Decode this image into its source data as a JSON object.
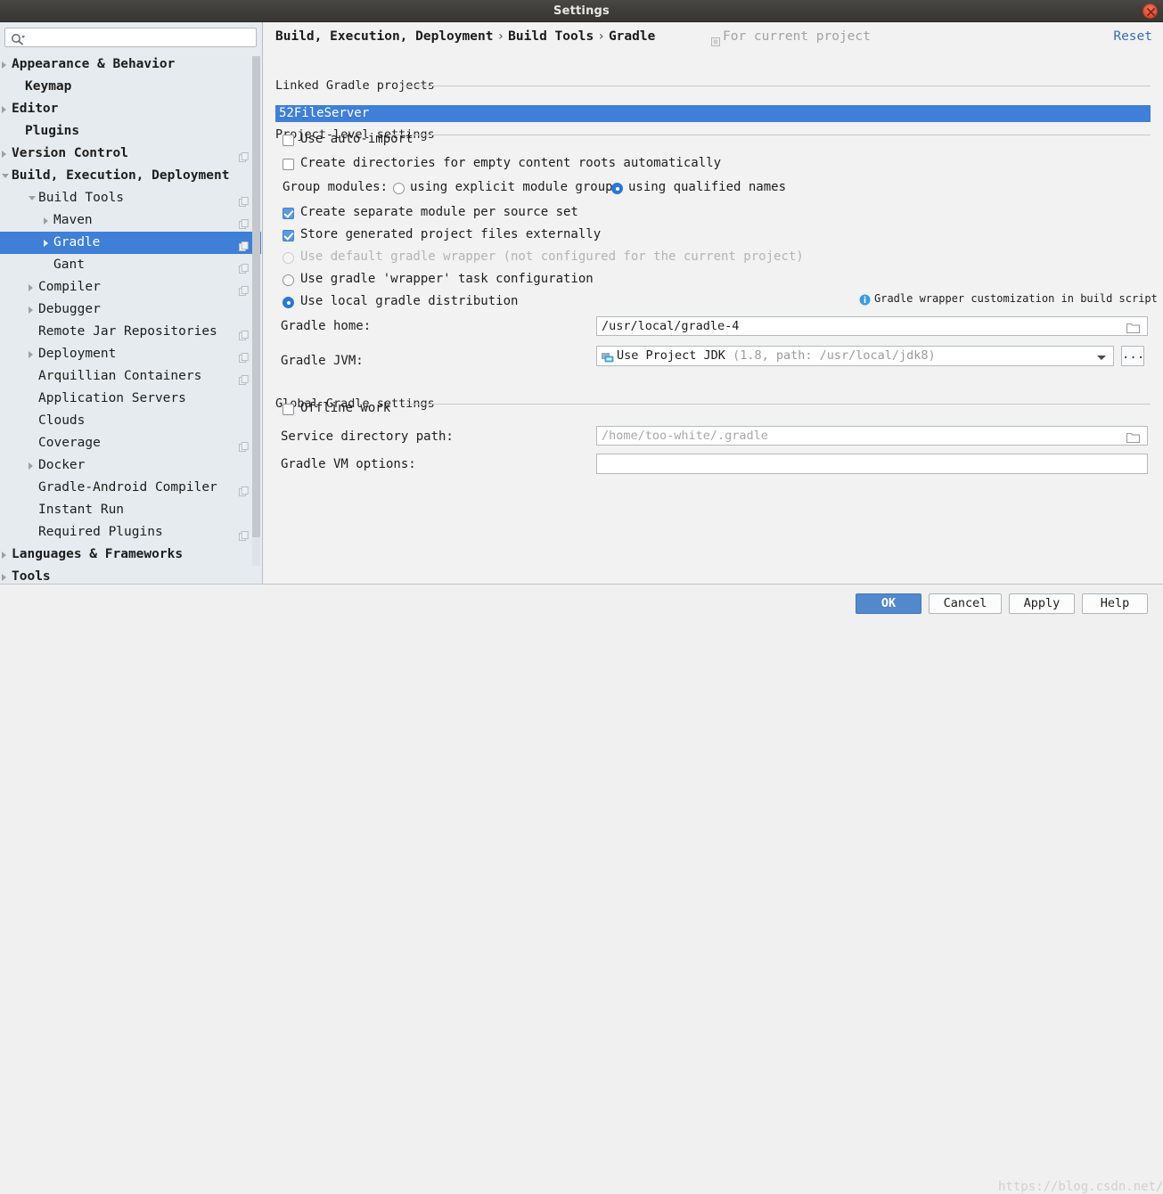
{
  "window": {
    "title": "Settings",
    "close_icon": "close-icon"
  },
  "sidebar": {
    "search": {
      "placeholder": "",
      "value": "",
      "icon": "search-icon"
    },
    "items": [
      {
        "label": "Appearance & Behavior",
        "indent": 13,
        "arrow": "collapsed",
        "bold": true,
        "copy": false
      },
      {
        "label": "Keymap",
        "indent": 28,
        "arrow": "none",
        "bold": true,
        "copy": false
      },
      {
        "label": "Editor",
        "indent": 13,
        "arrow": "collapsed",
        "bold": true,
        "copy": false
      },
      {
        "label": "Plugins",
        "indent": 28,
        "arrow": "none",
        "bold": true,
        "copy": false
      },
      {
        "label": "Version Control",
        "indent": 13,
        "arrow": "collapsed",
        "bold": true,
        "copy": true
      },
      {
        "label": "Build, Execution, Deployment",
        "indent": 13,
        "arrow": "expanded",
        "bold": true,
        "copy": false
      },
      {
        "label": "Build Tools",
        "indent": 43,
        "arrow": "expanded",
        "bold": false,
        "copy": true
      },
      {
        "label": "Maven",
        "indent": 60,
        "arrow": "collapsed",
        "bold": false,
        "copy": true
      },
      {
        "label": "Gradle",
        "indent": 60,
        "arrow": "collapsed",
        "bold": false,
        "copy": true,
        "selected": true
      },
      {
        "label": "Gant",
        "indent": 60,
        "arrow": "none",
        "bold": false,
        "copy": true
      },
      {
        "label": "Compiler",
        "indent": 43,
        "arrow": "collapsed",
        "bold": false,
        "copy": true
      },
      {
        "label": "Debugger",
        "indent": 43,
        "arrow": "collapsed",
        "bold": false,
        "copy": false
      },
      {
        "label": "Remote Jar Repositories",
        "indent": 43,
        "arrow": "none",
        "bold": false,
        "copy": true
      },
      {
        "label": "Deployment",
        "indent": 43,
        "arrow": "collapsed",
        "bold": false,
        "copy": true
      },
      {
        "label": "Arquillian Containers",
        "indent": 43,
        "arrow": "none",
        "bold": false,
        "copy": true
      },
      {
        "label": "Application Servers",
        "indent": 43,
        "arrow": "none",
        "bold": false,
        "copy": false
      },
      {
        "label": "Clouds",
        "indent": 43,
        "arrow": "none",
        "bold": false,
        "copy": false
      },
      {
        "label": "Coverage",
        "indent": 43,
        "arrow": "none",
        "bold": false,
        "copy": true
      },
      {
        "label": "Docker",
        "indent": 43,
        "arrow": "collapsed",
        "bold": false,
        "copy": false
      },
      {
        "label": "Gradle-Android Compiler",
        "indent": 43,
        "arrow": "none",
        "bold": false,
        "copy": true
      },
      {
        "label": "Instant Run",
        "indent": 43,
        "arrow": "none",
        "bold": false,
        "copy": false
      },
      {
        "label": "Required Plugins",
        "indent": 43,
        "arrow": "none",
        "bold": false,
        "copy": true
      },
      {
        "label": "Languages & Frameworks",
        "indent": 13,
        "arrow": "collapsed",
        "bold": true,
        "copy": false
      },
      {
        "label": "Tools",
        "indent": 13,
        "arrow": "collapsed",
        "bold": true,
        "copy": false
      }
    ]
  },
  "header": {
    "breadcrumb": [
      "Build, Execution, Deployment",
      "Build Tools",
      "Gradle"
    ],
    "separator": "›",
    "scope_text": "For current project",
    "scope_icon": "project-scope-icon",
    "reset_label": "Reset"
  },
  "main": {
    "linked_section_label": "Linked Gradle projects",
    "linked_project": "52FileServer",
    "project_section_label": "Project-level settings",
    "global_section_label": "Global Gradle settings",
    "checkbox_auto_import": {
      "label": "Use auto-import",
      "checked": false
    },
    "checkbox_create_dirs": {
      "label": "Create directories for empty content roots automatically",
      "checked": false
    },
    "group_modules": {
      "label": "Group modules:",
      "option_explicit": "using explicit module groups",
      "option_qualified": "using qualified names",
      "selected": "using qualified names"
    },
    "checkbox_separate_module": {
      "label": "Create separate module per source set",
      "checked": true
    },
    "checkbox_store_external": {
      "label": "Store generated project files externally",
      "checked": true
    },
    "radio_default_wrapper": {
      "label": "Use default gradle wrapper (not configured for the current project)",
      "checked": false,
      "disabled": true
    },
    "radio_task_wrapper": {
      "label": "Use gradle 'wrapper' task configuration",
      "checked": false,
      "disabled": false
    },
    "radio_local_dist": {
      "label": "Use local gradle distribution",
      "checked": true,
      "disabled": false
    },
    "info_hint": {
      "icon": "info-icon",
      "text": "Gradle wrapper customization in build script"
    },
    "gradle_home": {
      "label": "Gradle home:",
      "value": "/usr/local/gradle-4",
      "browse_icon": "folder-browse-icon"
    },
    "gradle_jvm": {
      "label": "Gradle JVM:",
      "icon": "jdk-icon",
      "value": "Use Project JDK",
      "detail": "(1.8, path: /usr/local/jdk8)",
      "browse_label": "...",
      "dropdown_icon": "chevron-down-icon"
    },
    "checkbox_offline": {
      "label": "Offline work",
      "checked": false
    },
    "service_dir": {
      "label": "Service directory path:",
      "placeholder": "/home/too-white/.gradle",
      "value": "",
      "browse_icon": "folder-browse-icon"
    },
    "vm_options": {
      "label": "Gradle VM options:",
      "value": "",
      "placeholder": ""
    }
  },
  "footer": {
    "ok": "OK",
    "cancel": "Cancel",
    "apply": "Apply",
    "help": "Help"
  },
  "watermark": "https://blog.csdn.net/too_white"
}
